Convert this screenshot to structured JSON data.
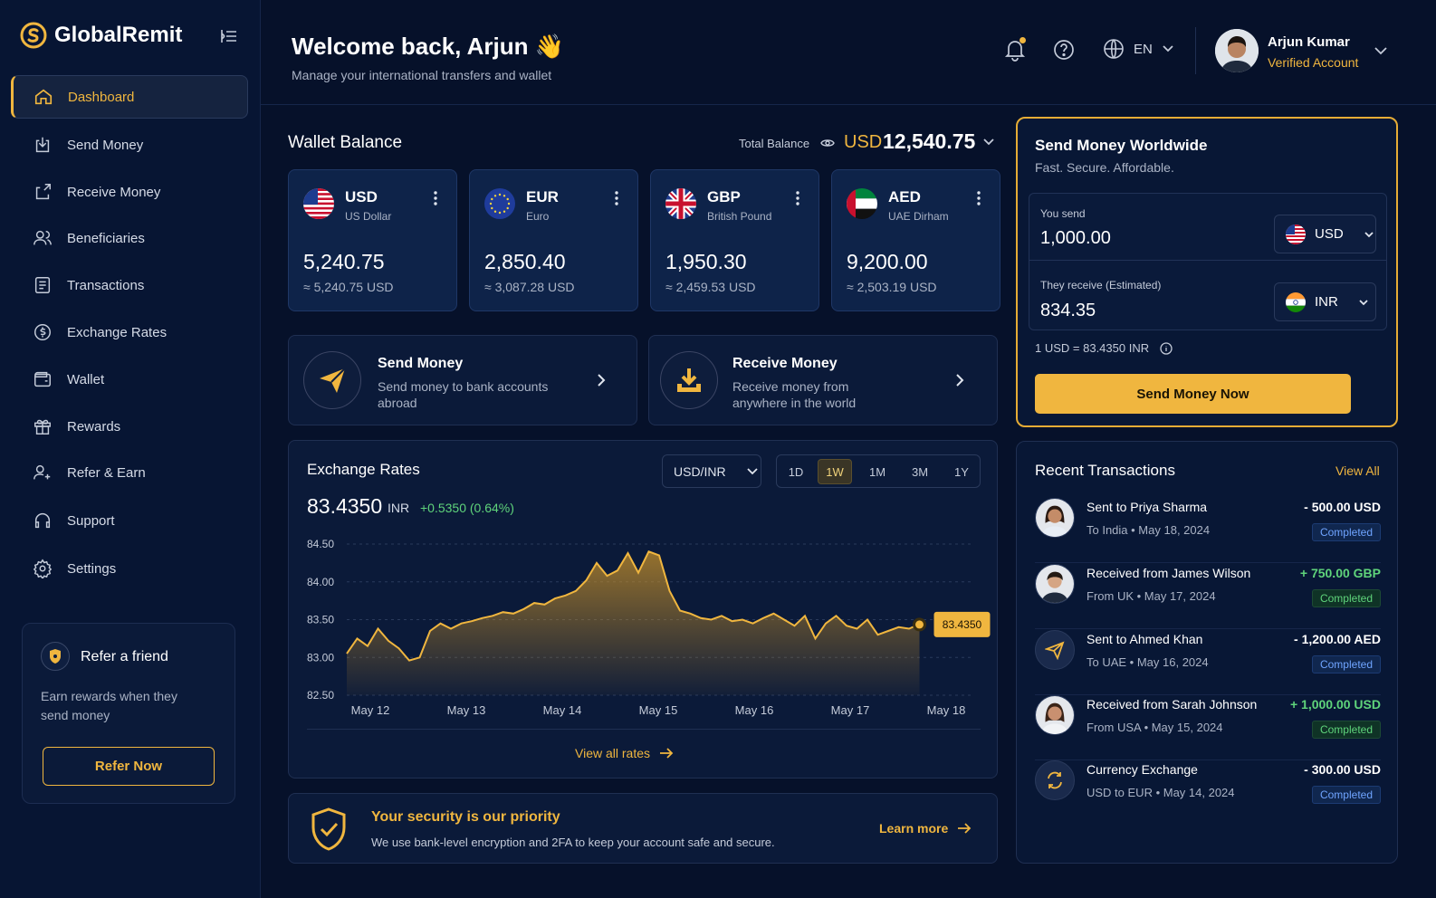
{
  "brand": {
    "name": "GlobalRemit",
    "accent": "#f0b63f"
  },
  "sidebar": {
    "items": [
      {
        "label": "Dashboard",
        "icon": "home-icon"
      },
      {
        "label": "Send Money",
        "icon": "send-down-icon"
      },
      {
        "label": "Receive Money",
        "icon": "receive-icon"
      },
      {
        "label": "Beneficiaries",
        "icon": "users-icon"
      },
      {
        "label": "Transactions",
        "icon": "list-icon"
      },
      {
        "label": "Exchange Rates",
        "icon": "dollar-icon"
      },
      {
        "label": "Wallet",
        "icon": "wallet-icon"
      },
      {
        "label": "Rewards",
        "icon": "gift-icon"
      },
      {
        "label": "Refer & Earn",
        "icon": "user-plus-icon"
      },
      {
        "label": "Support",
        "icon": "headset-icon"
      },
      {
        "label": "Settings",
        "icon": "gear-icon"
      }
    ],
    "refer": {
      "title": "Refer a friend",
      "desc": "Earn rewards when they send money",
      "button": "Refer Now"
    }
  },
  "header": {
    "welcome": "Welcome back, Arjun 👋",
    "subtitle": "Manage your international transfers and wallet",
    "language": "EN",
    "user_name": "Arjun Kumar",
    "user_status": "Verified Account"
  },
  "wallet": {
    "title": "Wallet Balance",
    "total_label": "Total Balance",
    "total_currency": "USD",
    "total_value": "12,540.75",
    "cards": [
      {
        "code": "USD",
        "name": "US Dollar",
        "amount": "5,240.75",
        "converted": "≈ 5,240.75 USD"
      },
      {
        "code": "EUR",
        "name": "Euro",
        "amount": "2,850.40",
        "converted": "≈ 3,087.28 USD"
      },
      {
        "code": "GBP",
        "name": "British Pound",
        "amount": "1,950.30",
        "converted": "≈ 2,459.53 USD"
      },
      {
        "code": "AED",
        "name": "UAE Dirham",
        "amount": "9,200.00",
        "converted": "≈ 2,503.19 USD"
      }
    ]
  },
  "actions": {
    "send": {
      "title": "Send Money",
      "desc": "Send money to bank accounts abroad"
    },
    "receive": {
      "title": "Receive Money",
      "desc": "Receive money from anywhere in the world"
    }
  },
  "exchange": {
    "title": "Exchange Rates",
    "pair": "USD/INR",
    "timeframes": [
      "1D",
      "1W",
      "1M",
      "3M",
      "1Y"
    ],
    "active_timeframe": "1W",
    "rate": "83.4350",
    "unit": "INR",
    "change": "+0.5350 (0.64%)",
    "view_all": "View all rates",
    "current_label": "83.4350"
  },
  "chart_data": {
    "type": "area",
    "x_labels": [
      "May 12",
      "May 13",
      "May 14",
      "May 15",
      "May 16",
      "May 17",
      "May 18"
    ],
    "y_ticks": [
      "84.50",
      "84.00",
      "83.50",
      "83.00",
      "82.50"
    ],
    "ylim": [
      82.5,
      84.5
    ],
    "xlim": [
      12,
      18
    ],
    "grid": true,
    "x": [
      12.0,
      12.1,
      12.2,
      12.3,
      12.4,
      12.5,
      12.6,
      12.7,
      12.8,
      12.9,
      13.0,
      13.1,
      13.2,
      13.3,
      13.4,
      13.5,
      13.6,
      13.7,
      13.8,
      13.9,
      14.0,
      14.1,
      14.2,
      14.3,
      14.4,
      14.5,
      14.6,
      14.7,
      14.8,
      14.9,
      15.0,
      15.1,
      15.2,
      15.3,
      15.4,
      15.5,
      15.6,
      15.7,
      15.8,
      15.9,
      16.0,
      16.1,
      16.2,
      16.3,
      16.4,
      16.5,
      16.6,
      16.7,
      16.8,
      16.9,
      17.0,
      17.1,
      17.2,
      17.3,
      17.4,
      17.5
    ],
    "values": [
      83.05,
      83.25,
      83.15,
      83.38,
      83.22,
      83.12,
      82.96,
      83.0,
      83.35,
      83.45,
      83.38,
      83.45,
      83.48,
      83.52,
      83.55,
      83.6,
      83.58,
      83.64,
      83.72,
      83.7,
      83.78,
      83.82,
      83.88,
      84.02,
      84.25,
      84.08,
      84.15,
      84.38,
      84.12,
      84.4,
      84.35,
      83.88,
      83.62,
      83.58,
      83.52,
      83.5,
      83.55,
      83.48,
      83.5,
      83.45,
      83.52,
      83.58,
      83.5,
      83.42,
      83.55,
      83.25,
      83.45,
      83.55,
      83.42,
      83.38,
      83.5,
      83.3,
      83.35,
      83.4,
      83.38,
      83.44
    ],
    "current": {
      "x": 17.5,
      "value": 83.435
    }
  },
  "security": {
    "title": "Your security is our priority",
    "desc": "We use bank-level encryption and 2FA to keep your account safe and secure.",
    "link": "Learn more"
  },
  "send_panel": {
    "title": "Send Money Worldwide",
    "subtitle": "Fast. Secure. Affordable.",
    "send_label": "You send",
    "send_value": "1,000.00",
    "send_currency": "USD",
    "receive_label": "They receive (Estimated)",
    "receive_value": "834.35",
    "receive_currency": "INR",
    "fx_note": "1 USD = 83.4350 INR",
    "button": "Send Money Now"
  },
  "transactions": {
    "title": "Recent Transactions",
    "view_all": "View All",
    "rows": [
      {
        "name": "Sent to Priya Sharma",
        "sub": "To India  •  May 18, 2024",
        "amount": "- 500.00 USD",
        "status": "Completed",
        "kind": "out"
      },
      {
        "name": "Received from James Wilson",
        "sub": "From UK  •  May 17, 2024",
        "amount": "+ 750.00 GBP",
        "status": "Completed",
        "kind": "in"
      },
      {
        "name": "Sent to Ahmed Khan",
        "sub": "To UAE  •  May 16, 2024",
        "amount": "- 1,200.00 AED",
        "status": "Completed",
        "kind": "out"
      },
      {
        "name": "Received from Sarah Johnson",
        "sub": "From USA  •  May 15, 2024",
        "amount": "+ 1,000.00 USD",
        "status": "Completed",
        "kind": "in"
      },
      {
        "name": "Currency Exchange",
        "sub": "USD to EUR  •  May 14, 2024",
        "amount": "- 300.00 USD",
        "status": "Completed",
        "kind": "out"
      }
    ]
  }
}
